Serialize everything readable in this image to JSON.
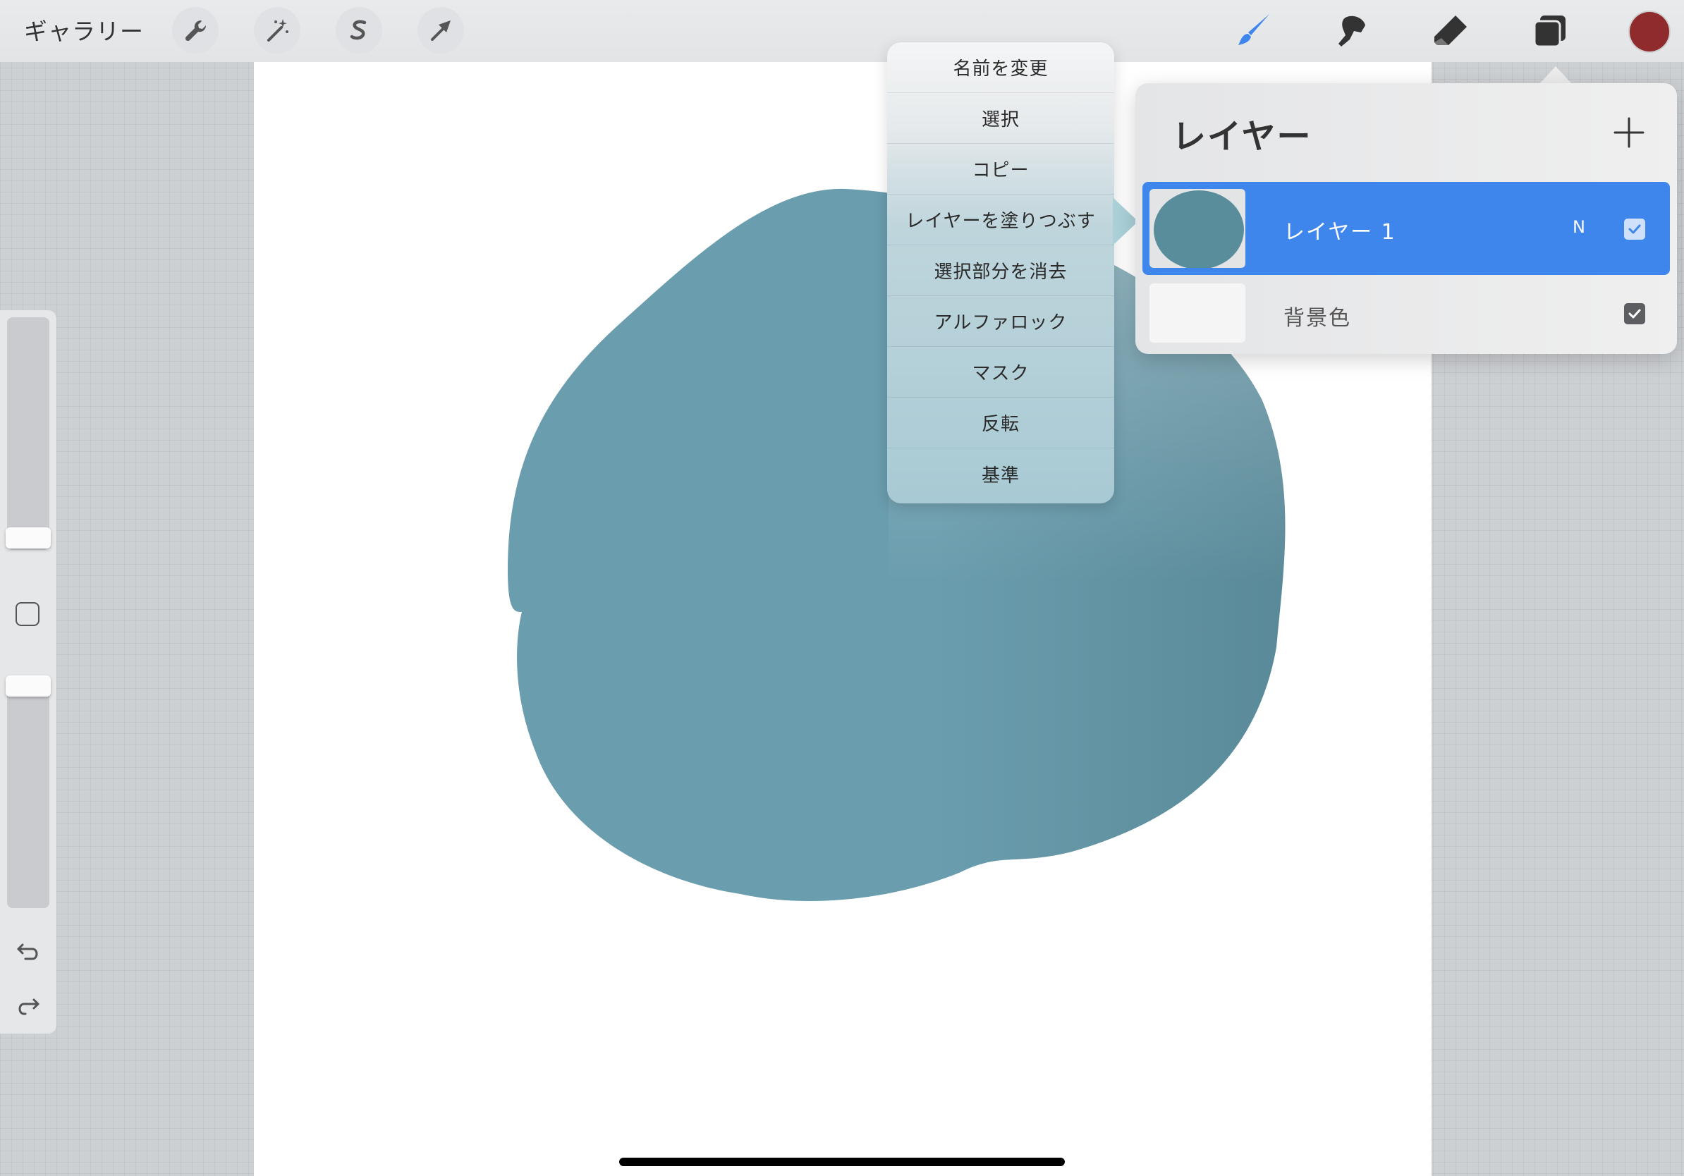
{
  "topbar": {
    "gallery_label": "ギャラリー",
    "left_tools": [
      "wrench-icon",
      "magic-wand-icon",
      "selection-s-icon",
      "transform-arrow-icon"
    ],
    "right_tools": [
      "brush-icon",
      "smudge-icon",
      "eraser-icon",
      "layers-icon"
    ],
    "current_color": "#8f2b2d"
  },
  "canvas": {
    "background": "#ffffff",
    "shape_color": "#6a9dae"
  },
  "context_menu": {
    "items": [
      "名前を変更",
      "選択",
      "コピー",
      "レイヤーを塗りつぶす",
      "選択部分を消去",
      "アルファロック",
      "マスク",
      "反転",
      "基準"
    ]
  },
  "layers_panel": {
    "title": "レイヤー",
    "layers": [
      {
        "name": "レイヤー 1",
        "blend_mode": "N",
        "visible": true,
        "active": true
      },
      {
        "name": "背景色",
        "visible": true,
        "active": false
      }
    ]
  },
  "colors": {
    "accent": "#3f86ec",
    "shape": "#6a9dae"
  }
}
